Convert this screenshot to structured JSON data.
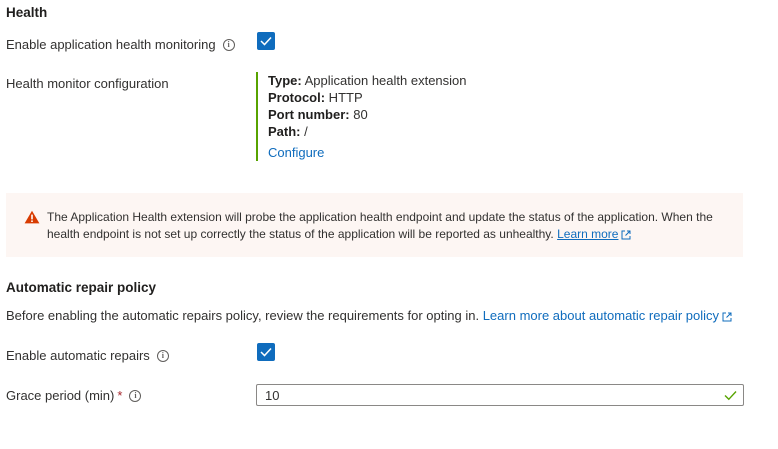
{
  "health": {
    "heading": "Health",
    "enable_monitoring_label": "Enable application health monitoring",
    "enable_monitoring_checked": true,
    "config_label": "Health monitor configuration",
    "config": [
      {
        "key": "Type:",
        "value": " Application health extension"
      },
      {
        "key": "Protocol:",
        "value": " HTTP"
      },
      {
        "key": "Port number:",
        "value": " 80"
      },
      {
        "key": "Path:",
        "value": " /"
      }
    ],
    "configure_link": "Configure"
  },
  "warning": {
    "text": "The Application Health extension will probe the application health endpoint and update the status of the application. When the health endpoint is not set up correctly the status of the application will be reported as unhealthy.",
    "learn_more": "Learn more",
    "icon": "warning-triangle-icon",
    "icon_color": "#d83b01",
    "background": "#fdf6f3"
  },
  "repair": {
    "heading": "Automatic repair policy",
    "description": "Before enabling the automatic repairs policy, review the requirements for opting in.",
    "learn_more": "Learn more about automatic repair policy",
    "enable_label": "Enable automatic repairs",
    "enable_checked": true,
    "grace_label": "Grace period (min)",
    "grace_required": "*",
    "grace_value": "10"
  },
  "colors": {
    "accent": "#0f6cbd",
    "valid": "#57a300",
    "required": "#a4262c"
  }
}
